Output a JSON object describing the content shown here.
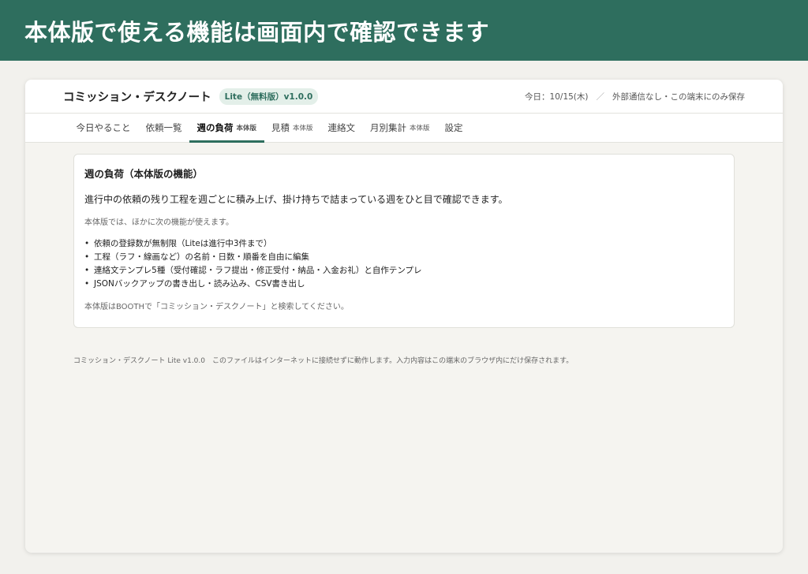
{
  "banner": {
    "text": "本体版で使える機能は画面内で確認できます"
  },
  "app": {
    "title": "コミッション・デスクノート",
    "badge": "Lite（無料版）v1.0.0",
    "today": "今日：10/15(木)",
    "separator": "／",
    "storage_note": "外部通信なし・この端末にのみ保存"
  },
  "tabs": [
    {
      "label": "今日やること",
      "tag": ""
    },
    {
      "label": "依頼一覧",
      "tag": ""
    },
    {
      "label": "週の負荷",
      "tag": "本体版"
    },
    {
      "label": "見積",
      "tag": "本体版"
    },
    {
      "label": "連絡文",
      "tag": ""
    },
    {
      "label": "月別集計",
      "tag": "本体版"
    },
    {
      "label": "設定",
      "tag": ""
    }
  ],
  "active_tab": "週の負荷",
  "card": {
    "title": "週の負荷（本体版の機能）",
    "lead": "進行中の依頼の残り工程を週ごとに積み上げ、掛け持ちで詰まっている週をひと目で確認できます。",
    "note": "本体版では、ほかに次の機能が使えます。",
    "features": [
      "依頼の登録数が無制限（Liteは進行中3件まで）",
      "工程（ラフ・線画など）の名前・日数・順番を自由に編集",
      "連絡文テンプレ5種（受付確認・ラフ提出・修正受付・納品・入金お礼）と自作テンプレ",
      "JSONバックアップの書き出し・読み込み、CSV書き出し"
    ],
    "footer": "本体版はBOOTHで「コミッション・デスクノート」と検索してください。"
  },
  "page_footer": "コミッション・デスクノート Lite v1.0.0　このファイルはインターネットに接続せずに動作します。入力内容はこの端末のブラウザ内にだけ保存されます。",
  "colors": {
    "brand": "#2e6e5e",
    "badge_bg": "#e3efe9",
    "background": "#f2f1ed"
  }
}
